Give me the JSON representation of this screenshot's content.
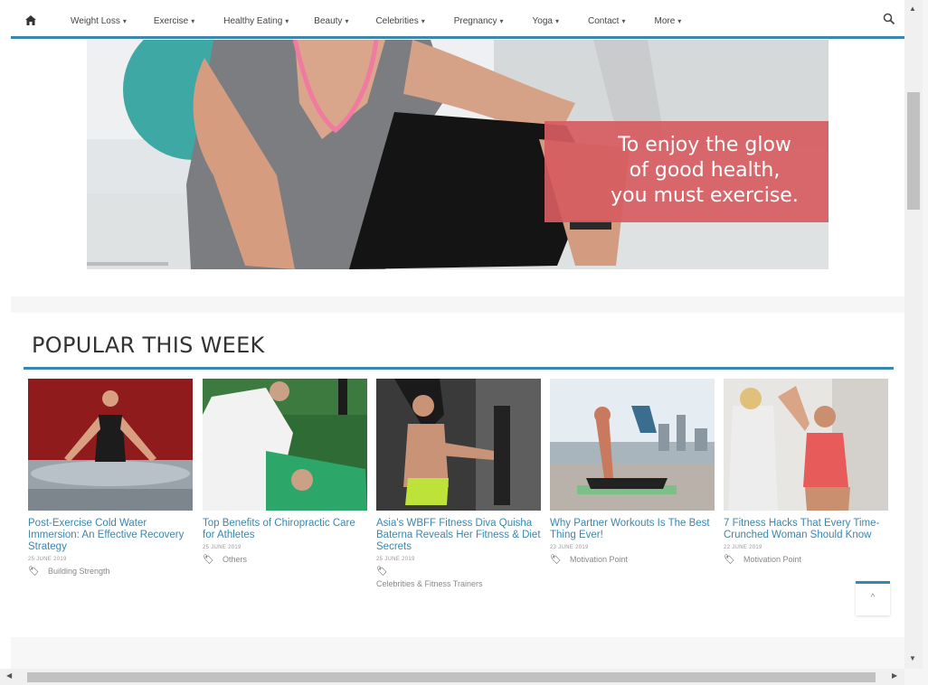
{
  "nav": {
    "items": [
      {
        "label": "Weight Loss",
        "caret": "▾"
      },
      {
        "label": "Exercise",
        "caret": "▾"
      },
      {
        "label": "Healthy Eating",
        "caret": "▾"
      },
      {
        "label": "Beauty",
        "caret": "▾"
      },
      {
        "label": "Celebrities",
        "caret": "▾"
      },
      {
        "label": "Pregnancy",
        "caret": "▾"
      },
      {
        "label": "Yoga",
        "caret": "▾"
      },
      {
        "label": "Contact",
        "caret": "▾"
      },
      {
        "label": "More",
        "caret": "▾"
      }
    ],
    "home_icon": "home-icon",
    "search_icon": "search-icon"
  },
  "hero": {
    "quote_lines": [
      "To enjoy the glow",
      "of good health,",
      "you must exercise."
    ]
  },
  "section": {
    "title": "POPULAR THIS WEEK"
  },
  "cards": [
    {
      "title": "Post-Exercise Cold Water Immersion: An Effective Recovery Strategy",
      "date": "25 JUNE 2019",
      "category": "Building Strength"
    },
    {
      "title": "Top Benefits of Chiropractic Care for Athletes",
      "date": "25 JUNE 2019",
      "category": "Others"
    },
    {
      "title": "Asia's WBFF Fitness Diva Quisha Baterna Reveals Her Fitness & Diet Secrets",
      "date": "25 JUNE 2019",
      "category": "Celebrities & Fitness Trainers"
    },
    {
      "title": "Why Partner Workouts Is The Best Thing Ever!",
      "date": "23 JUNE 2019",
      "category": "Motivation Point"
    },
    {
      "title": "7 Fitness Hacks That Every Time-Crunched Woman Should Know",
      "date": "22 JUNE 2019",
      "category": "Motivation Point"
    }
  ],
  "back_to_top": {
    "glyph": "^"
  },
  "colors": {
    "accent": "#3a87ad",
    "quote_bg": "#d65c5f",
    "link": "#3a87ad"
  }
}
